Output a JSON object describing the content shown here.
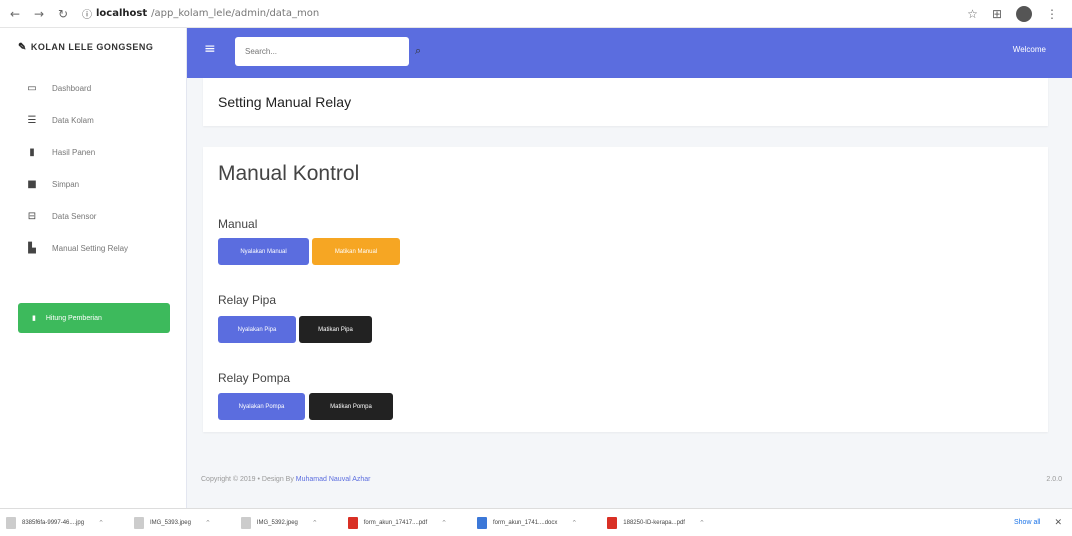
{
  "browser": {
    "url_host": "localhost",
    "url_path": "/app_kolam_lele/admin/data_mon",
    "star_icon": "☆",
    "extension_icon": "⊞",
    "menu_icon": "⋮"
  },
  "sidebar": {
    "brand": "KOLAN LELE GONGSENG",
    "items": [
      {
        "label": "Dashboard",
        "icon": "monitor-icon"
      },
      {
        "label": "Data Kolam",
        "icon": "list-icon"
      },
      {
        "label": "Hasil Panen",
        "icon": "bookmark-icon"
      },
      {
        "label": "Simpan",
        "icon": "square-icon"
      },
      {
        "label": "Data Sensor",
        "icon": "print-icon"
      },
      {
        "label": "Manual Setting Relay",
        "icon": "chart-icon"
      }
    ],
    "button_label": "Hitung Pemberian"
  },
  "topbar": {
    "search_placeholder": "Search...",
    "welcome": "Welcome"
  },
  "header": {
    "title": "Setting Manual Relay"
  },
  "main": {
    "title": "Manual Kontrol",
    "sections": [
      {
        "label": "Manual",
        "buttons": [
          "Nyalakan Manual",
          "Matikan Manual"
        ]
      },
      {
        "label": "Relay Pipa",
        "buttons": [
          "Nyalakan Pipa",
          "Matikan Pipa"
        ]
      },
      {
        "label": "Relay Pompa",
        "buttons": [
          "Nyalakan Pompa",
          "Matikan Pompa"
        ]
      }
    ]
  },
  "footer": {
    "copyright_prefix": "Copyright © 2019 • Design By",
    "author": "Muhamad Nauval Azhar",
    "version": "2.0.0"
  },
  "downloads": {
    "items": [
      {
        "name": "8385f6fa-9997-46....jpg",
        "type": "image"
      },
      {
        "name": "IMG_5393.jpeg",
        "type": "image"
      },
      {
        "name": "IMG_5392.jpeg",
        "type": "image"
      },
      {
        "name": "form_akun_17417....pdf",
        "type": "pdf"
      },
      {
        "name": "form_akun_1741....docx",
        "type": "doc"
      },
      {
        "name": "188250-ID-kerapa...pdf",
        "type": "pdf"
      }
    ],
    "show_all": "Show all"
  },
  "colors": {
    "primary": "#5b6ddf",
    "success": "#3dba5c",
    "warning": "#f6a623",
    "dark": "#222222"
  }
}
